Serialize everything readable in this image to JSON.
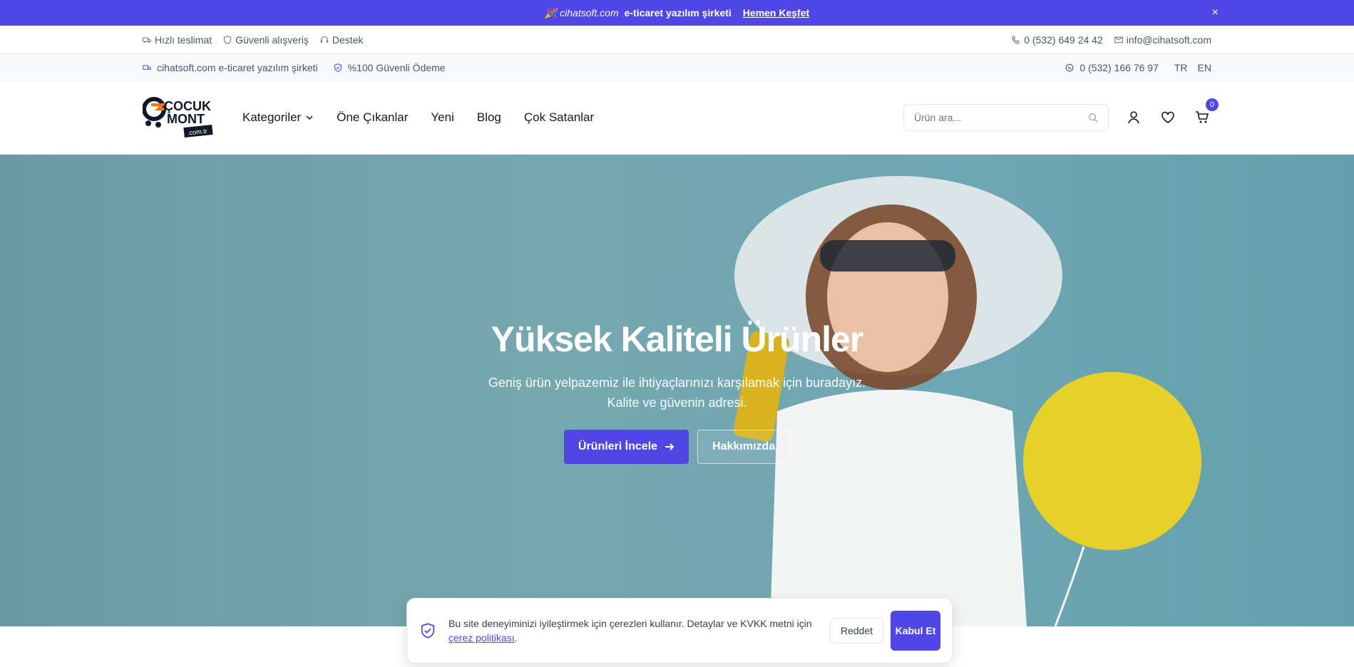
{
  "promo": {
    "brand": "🎉 cihatsoft.com",
    "tagline": "e-ticaret yazılım şirketi",
    "link": "Hemen Keşfet",
    "close": "×"
  },
  "util": {
    "left": [
      "Hızlı teslimat",
      "Güvenli alışveriş",
      "Destek"
    ],
    "phone": "0 (532) 649 24 42",
    "email": "info@cihatsoft.com"
  },
  "info": {
    "company": "cihatsoft.com e-ticaret yazılım şirketi",
    "payment": "%100 Güvenli Ödeme",
    "whatsapp": "0 (532) 166 76 97",
    "lang_tr": "TR",
    "lang_en": "EN"
  },
  "logo": {
    "line1": "ÇOCUK",
    "line2": "MONT",
    "line3": ".com.tr"
  },
  "nav": {
    "items": [
      "Kategoriler",
      "Öne Çıkanlar",
      "Yeni",
      "Blog",
      "Çok Satanlar"
    ]
  },
  "search": {
    "placeholder": "Ürün ara..."
  },
  "cart": {
    "count": "0"
  },
  "hero": {
    "title": "Yüksek Kaliteli Ürünler",
    "subtitle1": "Geniş ürün yelpazemiz ile ihtiyaçlarınızı karşılamak için buradayız.",
    "subtitle2": "Kalite ve güvenin adresi.",
    "primary": "Ürünleri İncele",
    "secondary": "Hakkımızda"
  },
  "cookie": {
    "text": "Bu site deneyiminizi iyileştirmek için çerezleri kullanır. Detaylar ve KVKK metni için",
    "link": "çerez politikası",
    "reject": "Reddet",
    "accept": "Kabul Et"
  },
  "colors": {
    "accent": "#4f46e5",
    "hero_bg": "#6fa6b3"
  }
}
